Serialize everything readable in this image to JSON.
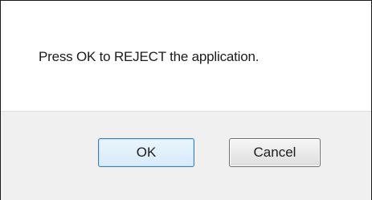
{
  "dialog": {
    "message": "Press OK to REJECT the application.",
    "buttons": {
      "ok_label": "OK",
      "cancel_label": "Cancel"
    }
  },
  "colors": {
    "ok_border": "#3c7fb1",
    "button_bar_background": "#f0f0f0"
  }
}
